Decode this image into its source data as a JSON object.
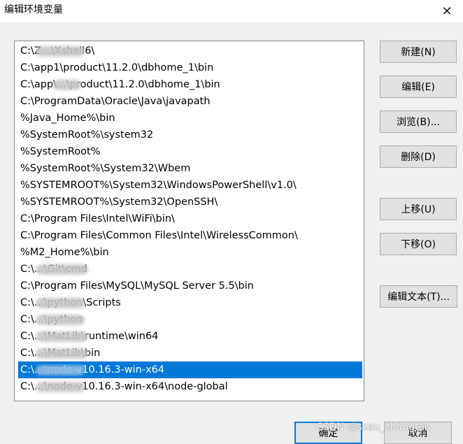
{
  "window": {
    "title": "编辑环境变量",
    "close_glyph": "✕"
  },
  "paths": [
    {
      "text": "C:\\Z...\\Xshell6\\",
      "blurs": [
        [
          25,
          70
        ]
      ]
    },
    {
      "text": "C:\\app1\\product\\11.2.0\\dbhome_1\\bin"
    },
    {
      "text": "C:\\app\\...\\product\\11.2.0\\dbhome_1\\bin",
      "blurs": [
        [
          50,
          40
        ]
      ]
    },
    {
      "text": "C:\\ProgramData\\Oracle\\Java\\javapath"
    },
    {
      "text": "%Java_Home%\\bin"
    },
    {
      "text": "%SystemRoot%\\system32"
    },
    {
      "text": "%SystemRoot%"
    },
    {
      "text": "%SystemRoot%\\System32\\Wbem"
    },
    {
      "text": "%SYSTEMROOT%\\System32\\WindowsPowerShell\\v1.0\\"
    },
    {
      "text": "%SYSTEMROOT%\\System32\\OpenSSH\\"
    },
    {
      "text": "C:\\Program Files\\Intel\\WiFi\\bin\\"
    },
    {
      "text": "C:\\Program Files\\Common Files\\Intel\\WirelessCommon\\"
    },
    {
      "text": "%M2_Home%\\bin"
    },
    {
      "text": "C:\\...\\Git\\cmd",
      "blurs": [
        [
          25,
          75
        ]
      ]
    },
    {
      "text": "C:\\Program Files\\MySQL\\MySQL Server 5.5\\bin"
    },
    {
      "text": "C:\\...\\python\\Scripts",
      "blurs": [
        [
          25,
          70
        ]
      ]
    },
    {
      "text": "C:\\...\\python",
      "blurs": [
        [
          25,
          70
        ]
      ]
    },
    {
      "text": "C:\\...\\MatLib\\runtime\\win64",
      "blurs": [
        [
          25,
          75
        ]
      ]
    },
    {
      "text": "C:\\...\\MatLib\\bin",
      "blurs": [
        [
          25,
          75
        ]
      ]
    },
    {
      "text": "C:\\...\\node-v10.16.3-win-x64",
      "blurs": [
        [
          25,
          70
        ]
      ],
      "selected": true
    },
    {
      "text": "C:\\...\\node-v10.16.3-win-x64\\node-global",
      "blurs": [
        [
          25,
          70
        ]
      ]
    }
  ],
  "buttons": {
    "new": "新建(N)",
    "edit": "编辑(E)",
    "browse": "浏览(B)...",
    "delete": "删除(D)",
    "move_up": "上移(U)",
    "move_down": "下移(O)",
    "edit_text": "编辑文本(T)..."
  },
  "footer": {
    "ok": "确定",
    "cancel": "取消"
  },
  "watermark": "CSDN @sxau_zhangtao"
}
